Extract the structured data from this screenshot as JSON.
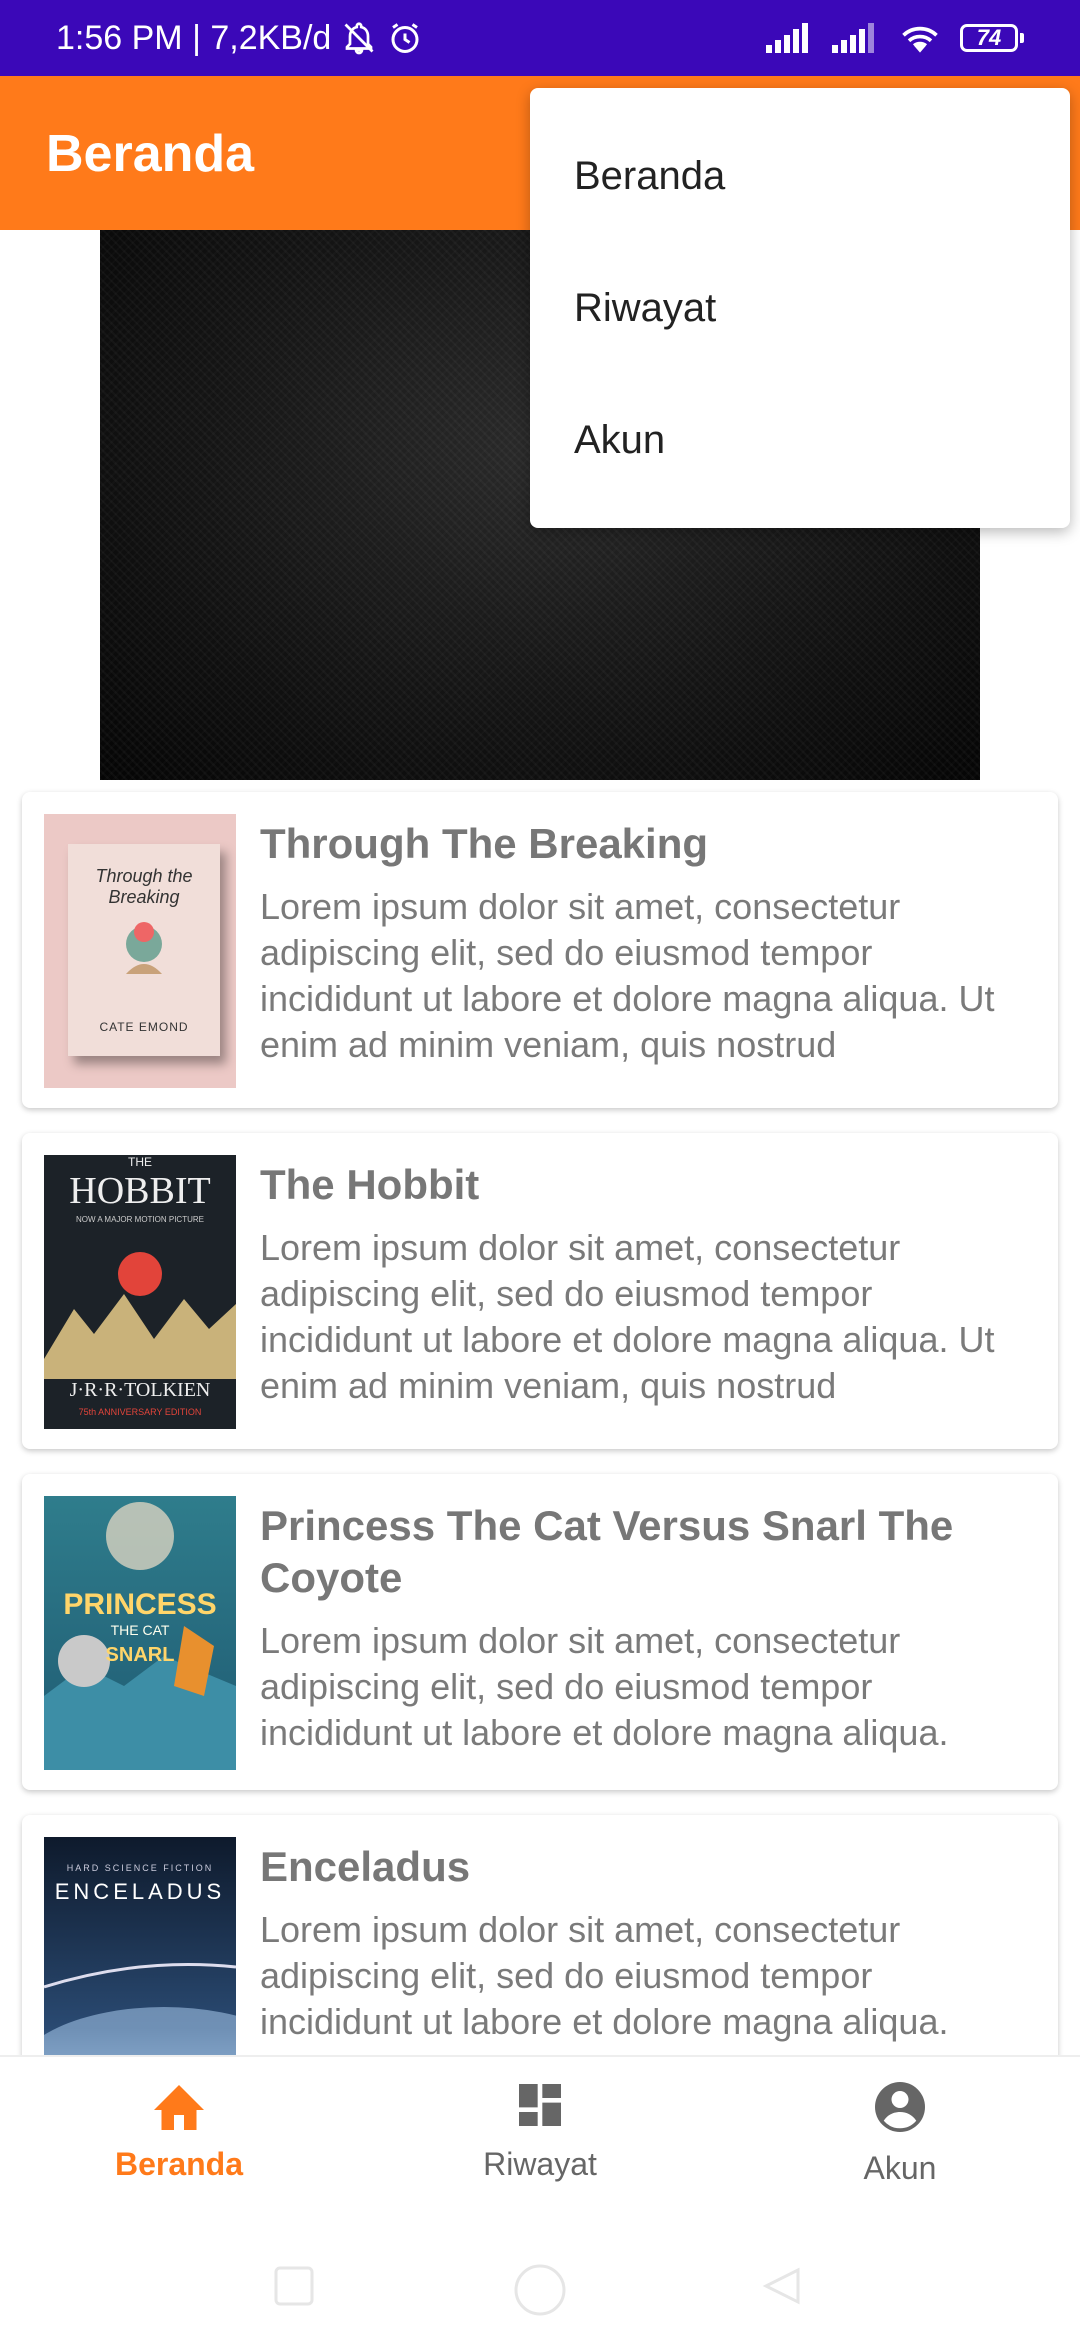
{
  "status_bar": {
    "left_text": "1:56 PM | 7,2KB/d",
    "battery": "74",
    "icons": [
      "bell-off-icon",
      "alarm-icon",
      "signal-icon",
      "signal-icon",
      "wifi-icon",
      "battery-icon"
    ]
  },
  "app_bar": {
    "title": "Beranda"
  },
  "menu": {
    "items": [
      {
        "label": "Beranda"
      },
      {
        "label": "Riwayat"
      },
      {
        "label": "Akun"
      }
    ]
  },
  "books": [
    {
      "title": "Through The Breaking",
      "description": "Lorem ipsum dolor sit amet, consectetur adipiscing elit, sed do eiusmod tempor incididunt ut labore et dolore magna aliqua. Ut enim ad minim veniam, quis nostrud",
      "cover": {
        "title": "Through the Breaking",
        "author": "CATE EMOND"
      }
    },
    {
      "title": "The Hobbit",
      "description": "Lorem ipsum dolor sit amet, consectetur adipiscing elit, sed do eiusmod tempor incididunt ut labore et dolore magna aliqua. Ut enim ad minim veniam, quis nostrud",
      "cover": {
        "small": "THE",
        "title": "HOBBIT",
        "tagline": "NOW A MAJOR MOTION PICTURE",
        "author": "J·R·R·TOLKIEN",
        "edition": "75th ANNIVERSARY EDITION"
      }
    },
    {
      "title": "Princess The Cat Versus Snarl The Coyote",
      "description": "Lorem ipsum dolor sit amet, consectetur adipiscing elit, sed do eiusmod tempor incididunt ut labore et dolore magna aliqua.",
      "cover": {
        "title": "PRINCESS",
        "sub1": "THE CAT",
        "sub2": "SNARL"
      }
    },
    {
      "title": "Enceladus",
      "description": "Lorem ipsum dolor sit amet, consectetur adipiscing elit, sed do eiusmod tempor incididunt ut labore et dolore magna aliqua.",
      "cover": {
        "tagline": "HARD SCIENCE FICTION",
        "title": "ENCELADUS"
      }
    }
  ],
  "bottom_nav": {
    "items": [
      {
        "label": "Beranda",
        "icon": "home-icon",
        "active": true
      },
      {
        "label": "Riwayat",
        "icon": "dashboard-icon",
        "active": false
      },
      {
        "label": "Akun",
        "icon": "account-circle-icon",
        "active": false
      }
    ]
  },
  "colors": {
    "status_bar": "#3B08B8",
    "app_bar": "#FF7A1A",
    "accent": "#FF7A1A"
  }
}
